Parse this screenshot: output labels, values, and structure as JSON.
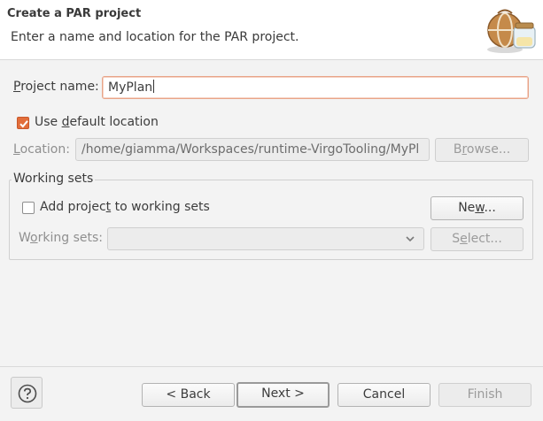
{
  "header": {
    "title": "Create a PAR project",
    "description": "Enter a name and location for the PAR project."
  },
  "project_name": {
    "label_mnemonic": "P",
    "label_rest": "roject name:",
    "value": "MyPlan"
  },
  "use_default": {
    "label_pre": "Use ",
    "label_mnemonic": "d",
    "label_post": "efault location",
    "checked": true
  },
  "location": {
    "label_mnemonic": "L",
    "label_rest": "ocation:",
    "value": "/home/giamma/Workspaces/runtime-VirgoTooling/MyPl",
    "browse_pre": "B",
    "browse_mnemonic": "r",
    "browse_post": "owse..."
  },
  "working_sets_group": {
    "title": "Working sets",
    "add_pre": "Add projec",
    "add_mnemonic": "t",
    "add_post": " to working sets",
    "add_checked": false,
    "new_pre": "Ne",
    "new_mnemonic": "w",
    "new_post": "...",
    "ws_label_pre": "W",
    "ws_label_mnemonic": "o",
    "ws_label_post": "rking sets:",
    "select_pre": "S",
    "select_mnemonic": "e",
    "select_post": "lect..."
  },
  "buttons": {
    "back": "< Back",
    "next": "Next >",
    "cancel": "Cancel",
    "finish": "Finish"
  },
  "icons": {
    "help": "help-icon",
    "wizard": "jar-and-globe-icon",
    "dropdown": "chevron-down-icon"
  },
  "colors": {
    "accent": "#e26e3b",
    "focus_border": "#e8a488"
  }
}
